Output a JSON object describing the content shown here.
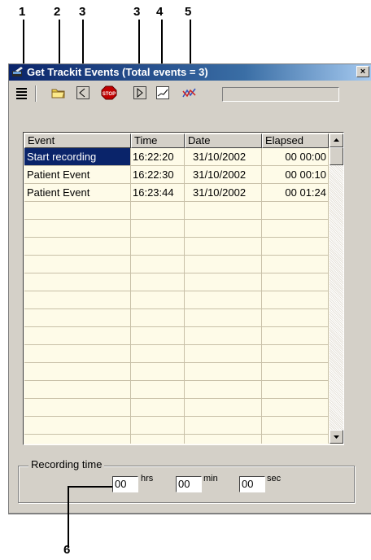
{
  "callouts": {
    "n1": "1",
    "n2": "2",
    "n3a": "3",
    "n3b": "3",
    "n4": "4",
    "n5": "5",
    "n6": "6"
  },
  "window": {
    "title": "Get Trackit Events (Total events = 3)",
    "close_label": "×"
  },
  "toolbar": {
    "status_text": ""
  },
  "table": {
    "headers": [
      "Event",
      "Time",
      "Date",
      "Elapsed"
    ],
    "rows": [
      {
        "event": "Start recording",
        "time": "16:22:20",
        "date": "31/10/2002",
        "elapsed": "00 00:00"
      },
      {
        "event": "Patient Event",
        "time": "16:22:30",
        "date": "31/10/2002",
        "elapsed": "00 00:10"
      },
      {
        "event": "Patient Event",
        "time": "16:23:44",
        "date": "31/10/2002",
        "elapsed": "00 01:24"
      }
    ],
    "selected_row": 0
  },
  "recording": {
    "legend": "Recording time",
    "hours_value": "00",
    "hours_unit": "hrs",
    "minutes_value": "00",
    "minutes_unit": "min",
    "seconds_value": "00",
    "seconds_unit": "sec"
  },
  "colors": {
    "titlebar": "#0a246a",
    "selection": "#0a246a",
    "grid_bg": "#fefbe8",
    "face": "#d4d0c8"
  },
  "icons": [
    "list-icon",
    "folder-icon",
    "play-back-icon",
    "stop-icon",
    "play-forward-icon",
    "chart-icon",
    "trend-icon"
  ]
}
